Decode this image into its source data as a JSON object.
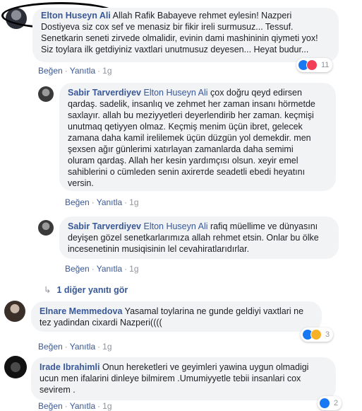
{
  "comments": [
    {
      "author": "Elton Huseyn Ali",
      "lines": [
        "Allah Rafik Babayeve rehmet eylesin! Nazperi",
        "Dostiyeva siz cox sef ve menasiz bir fikir ireli surmusuz... Tessuf.",
        "Senetkarin seneti zirvede olmalidir, evinin dami mashininin qiymeti yox!",
        "Siz toylara ilk getdiyiniz vaxtlari unutmusuz deyesen... Heyat budur..."
      ],
      "actions": {
        "like": "Beğen",
        "reply": "Yanıtla",
        "time": "1g"
      },
      "reaction_count": "11",
      "reaction_colors": [
        "#1877f2",
        "#f33e58"
      ],
      "replies": [
        {
          "author": "Sabir Tarverdiyev",
          "tag": "Elton Huseyn Ali",
          "lines": [
            "çox doğru qeyd edirsen",
            "qardaş. sadelik, insanlıq ve zehmet her zaman insanı hörmetde",
            "saxlayır. allah bu meziyyetleri deyerlendirib her zaman. keçmişi",
            "unutmaq qetiyyen olmaz. Keçmiş menim üçün ibret, gelecek",
            "zamana daha kamil irelilemek üçün düzgün yol demekdir. men",
            "şexsen ağır günlerimi xatırlayan zamanlarda daha semimi",
            "oluram qardaş. Allah her kesin yardımçısı olsun. xeyir emel",
            "sahiblerini o cümleden senin axirетde seadetli ebedi heyatını",
            "versin."
          ],
          "actions": {
            "like": "Beğen",
            "reply": "Yanıtla",
            "time": "1g"
          }
        },
        {
          "author": "Sabir Tarverdiyev",
          "tag": "Elton Huseyn Ali",
          "lines": [
            "rafiq müellime ve dünyasını",
            "deyişen gözel senetkarlarımıza allah rehmet etsin. Onlar bu ölke",
            "incesenetinin musiqisinin lel cevahiratlarıdırlar."
          ],
          "actions": {
            "like": "Beğen",
            "reply": "Yanıtla",
            "time": "1g"
          }
        }
      ],
      "more_replies": "1 diğer yanıtı gör"
    },
    {
      "author": "Elnare Memmedova",
      "lines": [
        "Yasamal toylarina ne gunde geldiyi vaxtlari ne",
        "tez yadindan cixardi Nazperi(((("
      ],
      "actions": {
        "like": "Beğen",
        "reply": "Yanıtla",
        "time": "1g"
      },
      "reaction_count": "3",
      "reaction_colors": [
        "#1877f2",
        "#f7b125"
      ]
    },
    {
      "author": "Irade Ibrahimli",
      "lines": [
        "Onun hereketleri ve geyimleri yawina uygun olmadigi",
        "ucun men ifalarini dinleye bilmirem .Umumiyyetle tebii insanlari cox",
        "sevirem ."
      ],
      "actions": {
        "like": "Beğen",
        "reply": "Yanıtla",
        "time": "1g"
      },
      "reaction_count": "2",
      "reaction_colors": [
        "#1877f2"
      ]
    }
  ]
}
